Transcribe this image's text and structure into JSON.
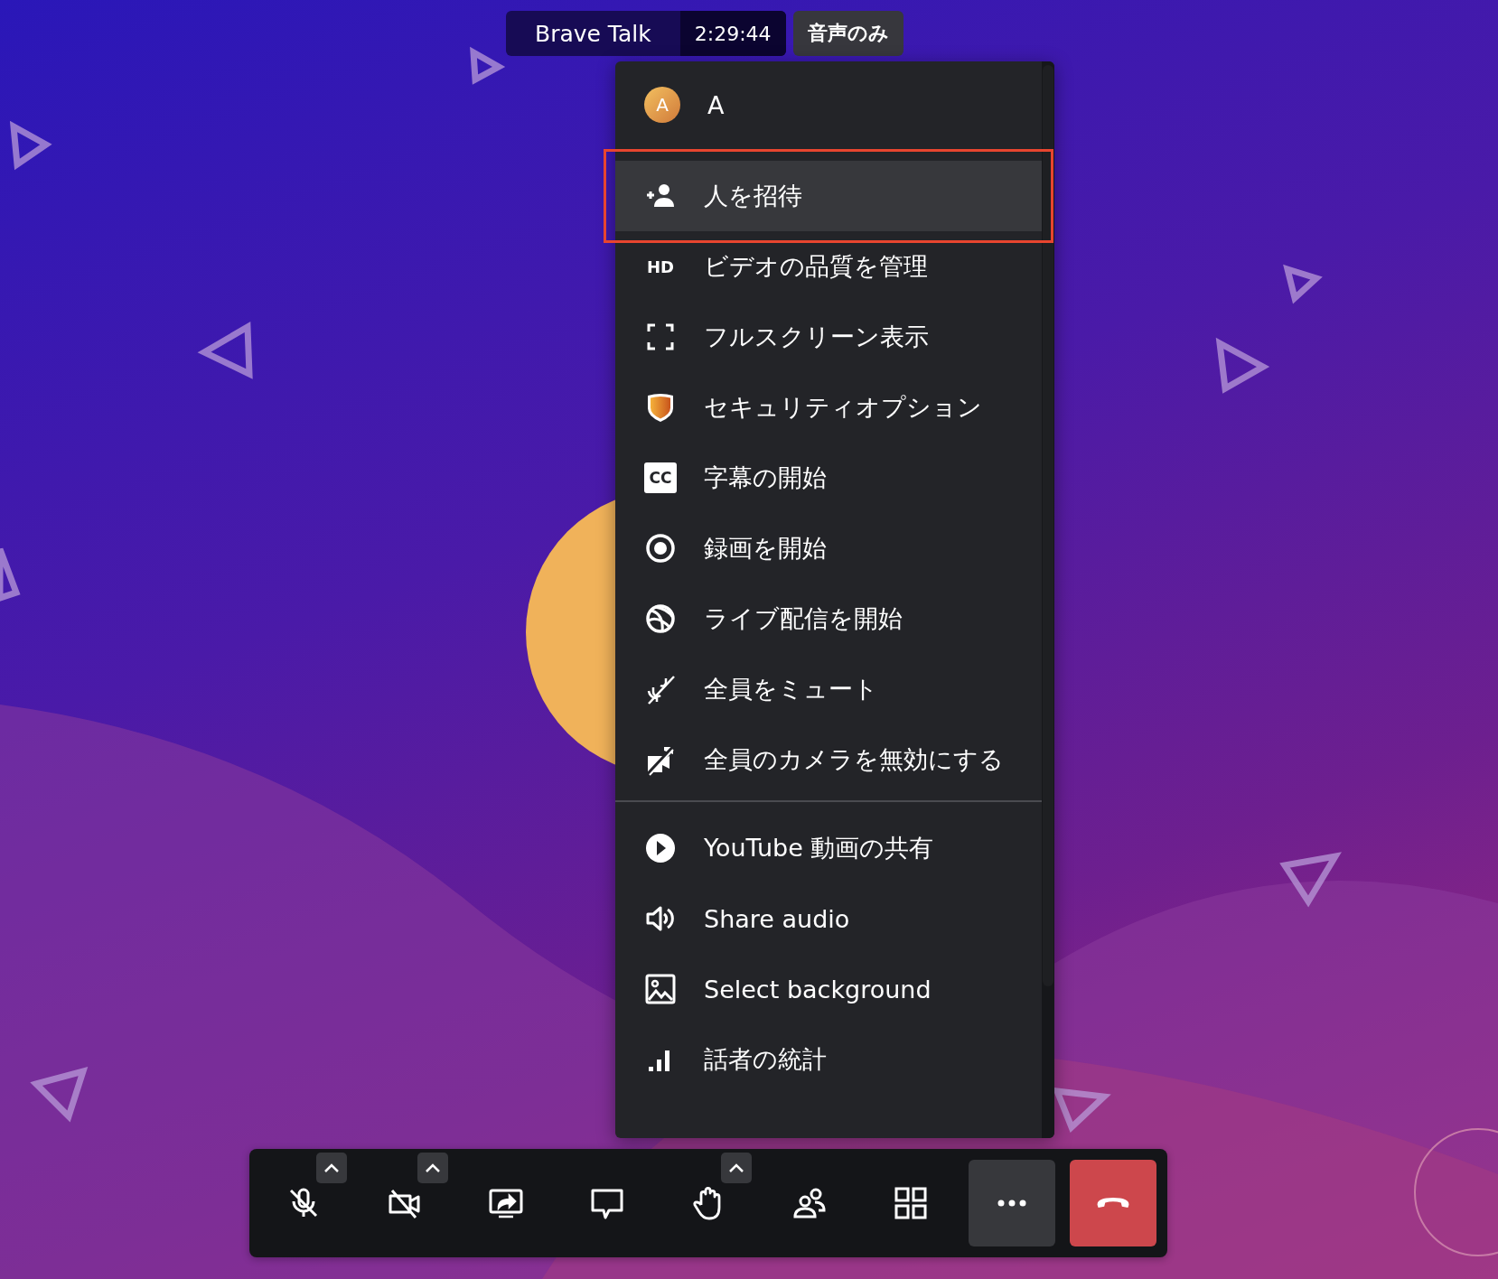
{
  "header": {
    "title": "Brave Talk",
    "timer": "2:29:44",
    "mode_button": "音声のみ"
  },
  "menu": {
    "user": {
      "initial": "A",
      "name": "A"
    },
    "items": [
      {
        "kind": "invite",
        "label": "人を招待",
        "selected": true,
        "outlined": true
      },
      {
        "kind": "hd",
        "label": "ビデオの品質を管理",
        "icon_text": "HD",
        "selected": false,
        "outlined": false
      },
      {
        "kind": "fullscreen",
        "label": "フルスクリーン表示",
        "selected": false,
        "outlined": false
      },
      {
        "kind": "shield",
        "label": "セキュリティオプション",
        "selected": false,
        "outlined": false
      },
      {
        "kind": "cc",
        "label": "字幕の開始",
        "icon_text": "CC",
        "selected": false,
        "outlined": false
      },
      {
        "kind": "record",
        "label": "録画を開始",
        "selected": false,
        "outlined": false
      },
      {
        "kind": "live",
        "label": "ライブ配信を開始",
        "selected": false,
        "outlined": false
      },
      {
        "kind": "mute_all",
        "label": "全員をミュート",
        "selected": false,
        "outlined": false
      },
      {
        "kind": "camera_off_all",
        "label": "全員のカメラを無効にする",
        "selected": false,
        "outlined": false
      },
      {
        "kind": "youtube",
        "label": "YouTube 動画の共有",
        "selected": false,
        "outlined": false,
        "divider_before": true
      },
      {
        "kind": "audio",
        "label": "Share audio",
        "selected": false,
        "outlined": false
      },
      {
        "kind": "background",
        "label": "Select background",
        "selected": false,
        "outlined": false
      },
      {
        "kind": "stats",
        "label": "話者の統計",
        "selected": false,
        "outlined": false
      }
    ]
  },
  "toolbar": [
    {
      "kind": "mic_off",
      "caret": true,
      "active": false
    },
    {
      "kind": "camera_off",
      "caret": true,
      "active": false
    },
    {
      "kind": "screen_share",
      "caret": false,
      "active": false
    },
    {
      "kind": "chat",
      "caret": false,
      "active": false
    },
    {
      "kind": "raise_hand",
      "caret": true,
      "active": false
    },
    {
      "kind": "participants",
      "caret": false,
      "active": false
    },
    {
      "kind": "tile_view",
      "caret": false,
      "active": false
    },
    {
      "kind": "more",
      "caret": false,
      "active": true
    },
    {
      "kind": "hangup",
      "caret": false,
      "active": false
    }
  ]
}
